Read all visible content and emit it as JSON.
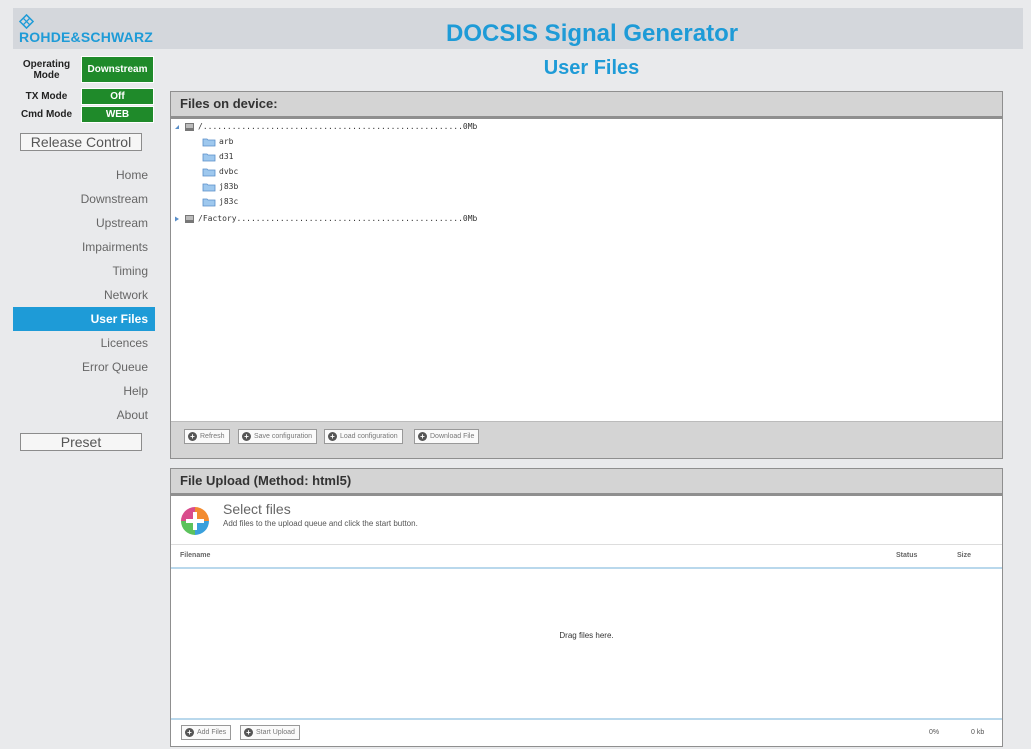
{
  "header": {
    "logo_text": "ROHDE&SCHWARZ",
    "app_title": "DOCSIS Signal Generator",
    "brand_color": "#1e9bd7"
  },
  "page_title": "User Files",
  "status": {
    "operating_mode": {
      "label": "Operating Mode",
      "value": "Downstream"
    },
    "tx_mode": {
      "label": "TX Mode",
      "value": "Off"
    },
    "cmd_mode": {
      "label": "Cmd Mode",
      "value": "WEB"
    },
    "value_color": "#1f8a2a"
  },
  "release_control_label": "Release Control",
  "nav": {
    "items": [
      {
        "label": "Home"
      },
      {
        "label": "Downstream"
      },
      {
        "label": "Upstream"
      },
      {
        "label": "Impairments"
      },
      {
        "label": "Timing"
      },
      {
        "label": "Network"
      },
      {
        "label": "User Files",
        "active": true
      },
      {
        "label": "Licences"
      },
      {
        "label": "Error Queue"
      },
      {
        "label": "Help"
      },
      {
        "label": "About"
      }
    ]
  },
  "preset_label": "Preset",
  "files_panel": {
    "title": "Files on device:",
    "tree": {
      "root": {
        "name": "/......................................................0Mb",
        "expanded": true,
        "icon": "drive-icon"
      },
      "folders": [
        "arb",
        "d31",
        "dvbc",
        "j83b",
        "j83c"
      ],
      "factory": {
        "name": "/Factory...............................................0Mb",
        "expanded": false,
        "icon": "drive-icon"
      }
    },
    "toolbar": {
      "refresh": "Refresh",
      "save": "Save configuration",
      "load": "Load configuration",
      "download": "Download File"
    }
  },
  "upload_panel": {
    "title": "File Upload (Method: html5)",
    "select_title": "Select files",
    "select_desc": "Add files to the upload queue and click the start button.",
    "columns": {
      "filename": "Filename",
      "status": "Status",
      "size": "Size"
    },
    "drop_text": "Drag files here.",
    "toolbar": {
      "add": "Add Files",
      "start": "Start Upload"
    },
    "progress_percent": "0%",
    "total_size": "0 kb"
  }
}
